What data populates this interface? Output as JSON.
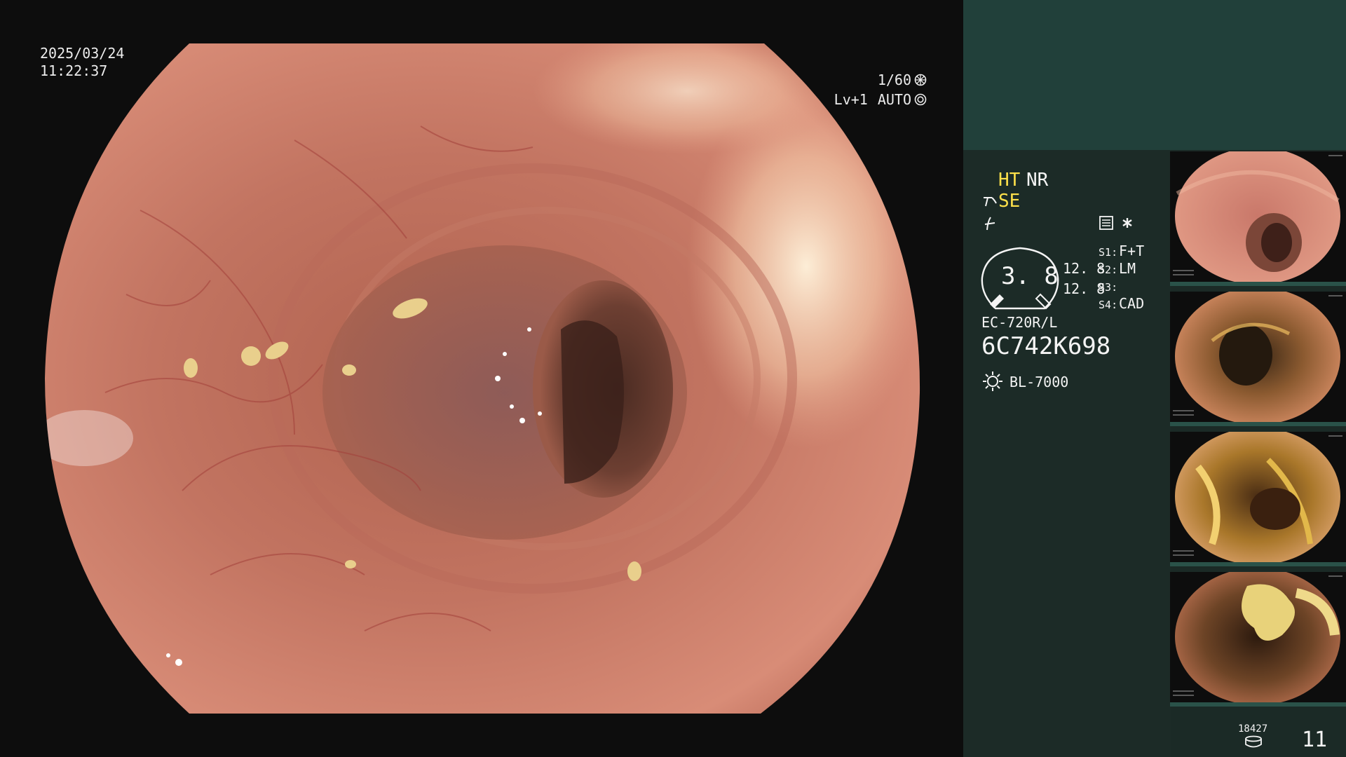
{
  "overlay": {
    "date": "2025/03/24",
    "time": "11:22:37",
    "shutter": "1/60",
    "level": "Lv+1",
    "exposure_mode": "AUTO"
  },
  "settings": {
    "ht": "HT",
    "nr": "NR",
    "se": "SE",
    "gauge_value": "3. 8",
    "value_top": "12. 8",
    "value_bottom": "12. 8",
    "s1_label": "S1",
    "s1_value": "F+T",
    "s2_label": "S2",
    "s2_value": "LM",
    "s3_label": "S3",
    "s3_value": "",
    "s4_label": "S4",
    "s4_value": "CAD",
    "scope_model": "EC-720R/L",
    "scope_serial": "6C742K698",
    "light_source": "BL-7000"
  },
  "footer": {
    "storage_count": "18427",
    "captured_count": "11"
  },
  "colors": {
    "highlight": "#ffe14a",
    "panel": "#1c2b27",
    "panel_top": "#21403a"
  },
  "thumbnails": [
    {
      "name": "thumbnail-1",
      "tone": "pink-lumen"
    },
    {
      "name": "thumbnail-2",
      "tone": "dark-residue"
    },
    {
      "name": "thumbnail-3",
      "tone": "yellow-residue"
    },
    {
      "name": "thumbnail-4",
      "tone": "dark-yellow-debris"
    }
  ]
}
